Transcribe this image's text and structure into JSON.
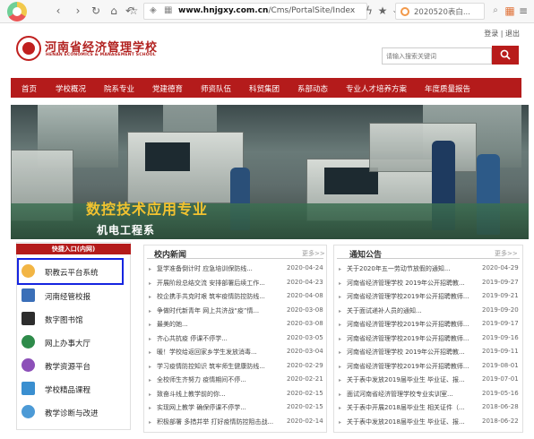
{
  "browser": {
    "url_host": "www.hnjgxy.com.cn",
    "url_path": "/Cms/PortalSite/Index",
    "search_text": "2020520表白..."
  },
  "header": {
    "title": "河南省经济管理学校",
    "subtitle": "HENAN ECONOMICS & MANAGEMENT SCHOOL",
    "login_label": "登录",
    "separator": "|",
    "logout_label": "退出",
    "search_placeholder": "请输入搜索关键词"
  },
  "nav": {
    "items": [
      {
        "label": "首页"
      },
      {
        "label": "学校概况"
      },
      {
        "label": "院系专业"
      },
      {
        "label": "党建德育"
      },
      {
        "label": "师资队伍"
      },
      {
        "label": "科贸集团"
      },
      {
        "label": "系部动态"
      },
      {
        "label": "专业人才培养方案"
      },
      {
        "label": "年度质量报告"
      }
    ]
  },
  "banner": {
    "title": "数控技术应用专业",
    "subtitle": "机电工程系"
  },
  "quick_links": {
    "heading": "快捷入口(内网)",
    "items": [
      {
        "label": "职教云平台系统",
        "color": "#f2b544"
      },
      {
        "label": "河南经管校报",
        "color": "#3a6fb8"
      },
      {
        "label": "数字图书馆",
        "color": "#2d2d2d"
      },
      {
        "label": "网上办事大厅",
        "color": "#2e8b4a"
      },
      {
        "label": "教学资源平台",
        "color": "#8c4fb8"
      },
      {
        "label": "学校精品课程",
        "color": "#3a8fd0"
      },
      {
        "label": "教学诊断与改进",
        "color": "#4c9ad6"
      }
    ]
  },
  "campus_news": {
    "heading": "校内新闻",
    "more": "更多>>",
    "rows": [
      {
        "title": "复学准备倒计时 应急培训保防线...",
        "date": "2020-04-24"
      },
      {
        "title": "开展阶段总结交流 安排部署后续工作...",
        "date": "2020-04-23"
      },
      {
        "title": "校企携手共克时艰 筑牢疫情防控防线...",
        "date": "2020-04-08"
      },
      {
        "title": "争做时代新青年 网上共济战“疫”情...",
        "date": "2020-03-08"
      },
      {
        "title": "最美的她...",
        "date": "2020-03-08"
      },
      {
        "title": "齐心共抗疫 停课不停学...",
        "date": "2020-03-05"
      },
      {
        "title": "暖！学校给返回家乡学生发放消毒...",
        "date": "2020-03-04"
      },
      {
        "title": "学习疫情防控知识 筑牢师生健康防线...",
        "date": "2020-02-29"
      },
      {
        "title": "全校师生齐努力 疫情期间不停...",
        "date": "2020-02-21"
      },
      {
        "title": "致奋斗线上教学前的你...",
        "date": "2020-02-15"
      },
      {
        "title": "实现网上教学 确保停课不停学...",
        "date": "2020-02-15"
      },
      {
        "title": "积极部署 多措并举 打好疫情防控阻击战...",
        "date": "2020-02-14"
      }
    ]
  },
  "notices": {
    "heading": "通知公告",
    "more": "更多>>",
    "rows": [
      {
        "title": "关于2020年五一劳动节放假的通知...",
        "date": "2020-04-29"
      },
      {
        "title": "河南省经济管理学校 2019年公开招聘教...",
        "date": "2019-09-27"
      },
      {
        "title": "河南省经济管理学校2019年公开招聘教师...",
        "date": "2019-09-21"
      },
      {
        "title": "关于面试递补人员的通知...",
        "date": "2019-09-20"
      },
      {
        "title": "河南省经济管理学校2019年公开招聘教师...",
        "date": "2019-09-17"
      },
      {
        "title": "河南省经济管理学校2019年公开招聘教师...",
        "date": "2019-09-16"
      },
      {
        "title": "河南省经济管理学校 2019年公开招聘教...",
        "date": "2019-09-11"
      },
      {
        "title": "河南省经济管理学校2019年公开招聘教师...",
        "date": "2019-08-01"
      },
      {
        "title": "关于表中发放2019届毕业生 毕业证、报...",
        "date": "2019-07-01"
      },
      {
        "title": "面试河南省经济管理学校专业实训室...",
        "date": "2019-05-16"
      },
      {
        "title": "关于表中开展2018届毕业生 相关证件（...",
        "date": "2018-06-28"
      },
      {
        "title": "关于表中发放2018届毕业生 毕业证、报...",
        "date": "2018-06-22"
      }
    ]
  }
}
